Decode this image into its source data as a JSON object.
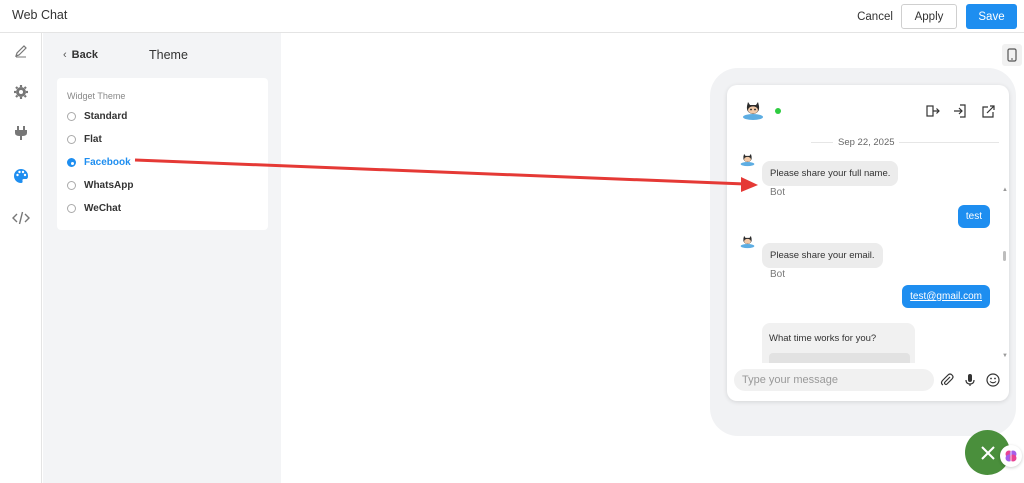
{
  "app": {
    "title": "Web Chat"
  },
  "toolbar": {
    "cancel_label": "Cancel",
    "apply_label": "Apply",
    "save_label": "Save"
  },
  "sidebar": {
    "icons": [
      "pencil-icon",
      "gear-icon",
      "plug-icon",
      "palette-icon",
      "code-icon"
    ],
    "active": "palette-icon"
  },
  "panel": {
    "back_label": "Back",
    "title": "Theme",
    "widget_theme_label": "Widget Theme",
    "options": [
      {
        "label": "Standard",
        "selected": false
      },
      {
        "label": "Flat",
        "selected": false
      },
      {
        "label": "Facebook",
        "selected": true
      },
      {
        "label": "WhatsApp",
        "selected": false
      },
      {
        "label": "WeChat",
        "selected": false
      }
    ]
  },
  "preview": {
    "device_icon": "mobile-phone-icon",
    "header_icons": [
      "exit-icon",
      "login-icon",
      "open-external-icon"
    ],
    "date": "Sep 22, 2025",
    "messages": [
      {
        "from": "bot",
        "text": "Please share your full name.",
        "sender": "Bot"
      },
      {
        "from": "user",
        "text": "test"
      },
      {
        "from": "bot",
        "text": "Please share your email.",
        "sender": "Bot"
      },
      {
        "from": "user",
        "text": "test@gmail.com"
      },
      {
        "from": "bot",
        "text": "What time works for you?"
      }
    ],
    "input_placeholder": "Type your message",
    "composer_icons": [
      "paperclip-icon",
      "microphone-icon",
      "smiley-icon"
    ]
  },
  "colors": {
    "accent": "#1e8ef0",
    "fab": "#4a8f3c",
    "annotation": "#e53935",
    "online": "#2ecc40"
  }
}
